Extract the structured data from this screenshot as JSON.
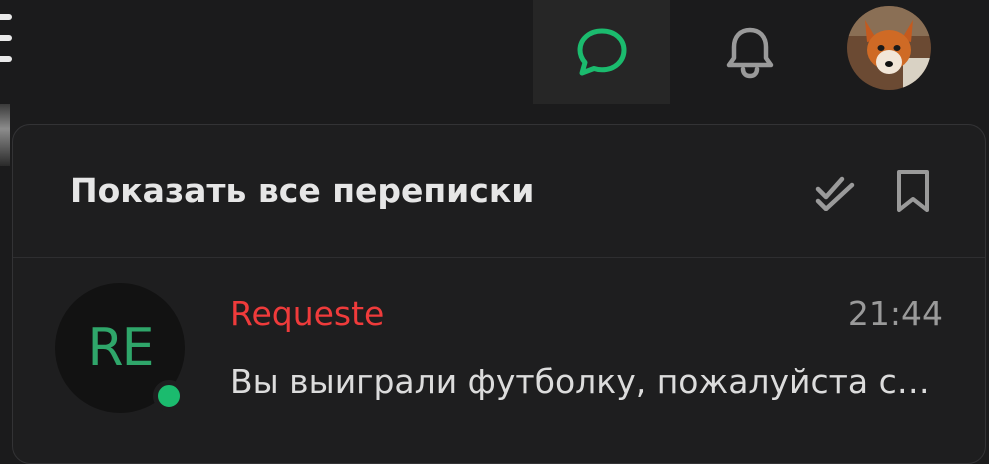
{
  "header": {
    "chat_icon": "chat-bubble-icon",
    "bell_icon": "bell-icon",
    "accent_color": "#1bbb6e"
  },
  "panel": {
    "title": "Показать все переписки",
    "mark_all_read_icon": "double-check-icon",
    "bookmark_icon": "bookmark-icon"
  },
  "conversations": [
    {
      "initials": "RE",
      "sender": "Requeste",
      "time": "21:44",
      "preview": "Вы выиграли футболку, пожалуйста св...",
      "online": true,
      "sender_color": "#ef3b3b"
    }
  ]
}
